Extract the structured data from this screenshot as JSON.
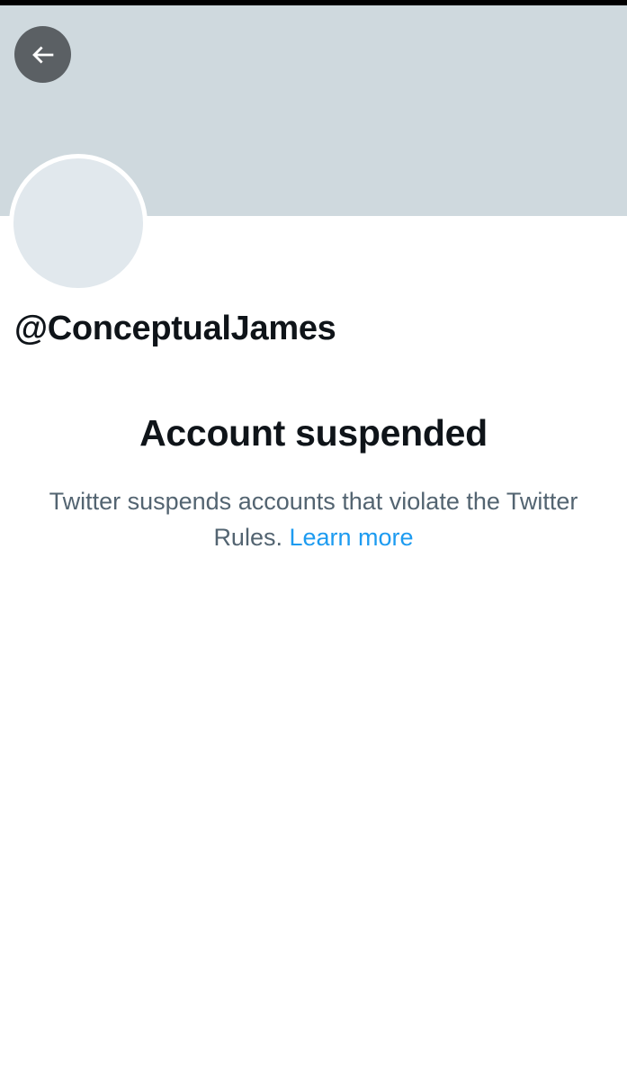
{
  "header": {
    "back_icon": "arrow-left-icon",
    "banner_color": "#cfd9de"
  },
  "profile": {
    "handle": "@ConceptualJames",
    "avatar_color": "#e1e8ed"
  },
  "suspension": {
    "title": "Account suspended",
    "message": "Twitter suspends accounts that violate the Twitter Rules.",
    "link_label": "Learn more",
    "link_color": "#1d9bf0"
  }
}
